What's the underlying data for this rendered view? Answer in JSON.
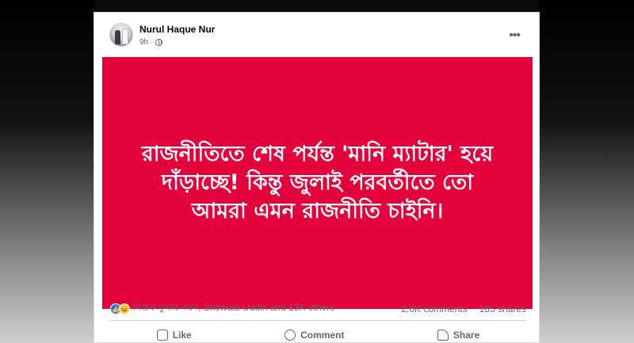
{
  "post": {
    "author": "Nurul Haque Nur",
    "time": "9h",
    "banner_text": "রাজনীতিতে শেষ পর্যন্ত 'মানি ম্যাটার' হয়ে দাঁড়াচ্ছে! কিন্তু জুলাই পরবর্তীতে তো আমরা এমন রাজনীতি চাইনি।",
    "banner_color": "#e4023c"
  },
  "engagement": {
    "reactions_text": "মিশুক কুমার নয়ন, Showaib Uddin and 13K others",
    "comments": "2.6K comments",
    "shares": "185 shares",
    "reaction_icons": [
      "like-icon",
      "haha-icon"
    ]
  },
  "actions": {
    "like": "Like",
    "comment": "Comment",
    "share": "Share"
  }
}
